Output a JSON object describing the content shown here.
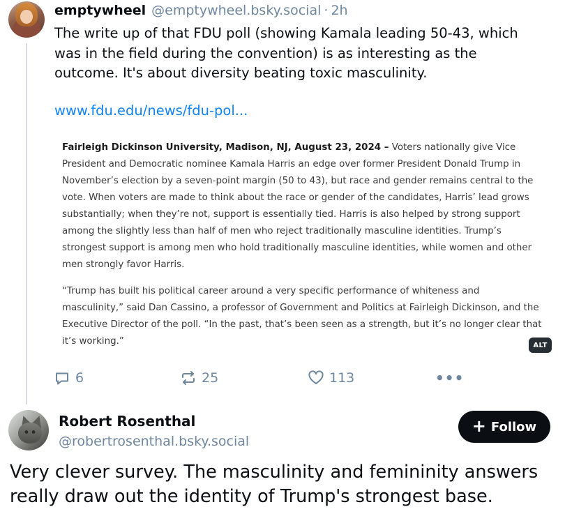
{
  "parent_post": {
    "author_name": "emptywheel",
    "author_handle": "@emptywheel.bsky.social",
    "separator": "·",
    "time": "2h",
    "text": "The write up of that FDU poll (showing Kamala leading 50-43, which was in the field during the convention) is as interesting as the outcome. It's about diversity beating toxic masculinity.",
    "link_text": "www.fdu.edu/news/fdu-pol...",
    "embed": {
      "para1_lead": "Fairleigh Dickinson University, Madison, NJ, August 23, 2024 –",
      "para1_body": " Voters nationally give Vice President and Democratic nominee Kamala Harris an edge over former President Donald Trump in November’s election by a seven-point margin (50 to 43), but race and gender remains central to the vote. When voters are made to think about the race or gender of the candidates, Harris’ lead grows substantially; when they’re not, support is essentially tied. Harris is also helped by strong support among the slightly less than half of men who reject traditionally masculine identities. Trump’s strongest support is among men who hold traditionally masculine identities, while women and other men strongly favor Harris.",
      "para2": "“Trump has built his political career around a very specific performance of whiteness and masculinity,” said Dan Cassino, a professor of Government and Politics at Fairleigh Dickinson, and the Executive Director of the poll. “In the past, that’s been seen as a strength, but it’s no longer clear that it’s working.”",
      "alt_badge": "ALT"
    },
    "actions": {
      "reply_count": "6",
      "repost_count": "25",
      "like_count": "113",
      "more_label": "•••"
    }
  },
  "reply_post": {
    "author_name": "Robert Rosenthal",
    "author_handle": "@robertrosenthal.bsky.social",
    "follow_label": "Follow",
    "text": "Very clever survey. The masculinity and femininity answers really draw out the identity of Trump's strongest base."
  },
  "icons": {
    "reply": "speech-bubble-icon",
    "repost": "repost-arrows-icon",
    "like": "heart-icon",
    "more": "ellipsis-icon",
    "follow": "plus-icon"
  },
  "colors": {
    "text": "#0b0f14",
    "muted": "#6f869f",
    "link": "#1083fe",
    "thread_line": "#d4dbe2",
    "button_bg": "#0b0f14"
  }
}
